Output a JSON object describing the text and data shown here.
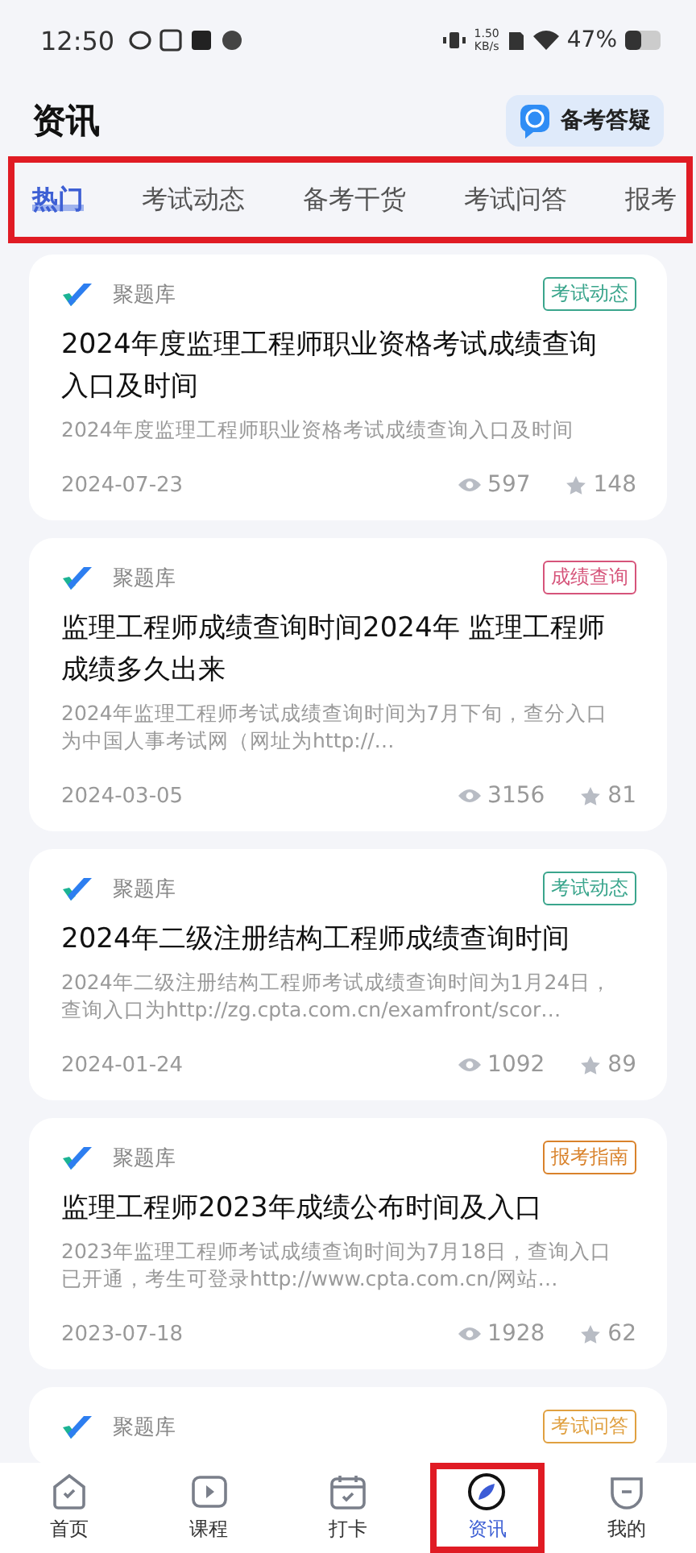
{
  "status_bar": {
    "time": "12:50",
    "net_speed_value": "1.50",
    "net_speed_unit": "KB/s",
    "battery": "47%"
  },
  "header": {
    "title": "资讯",
    "action": "备考答疑"
  },
  "tabs": [
    {
      "label": "热门",
      "selected": true
    },
    {
      "label": "考试动态",
      "selected": false
    },
    {
      "label": "备考干货",
      "selected": false
    },
    {
      "label": "考试问答",
      "selected": false
    },
    {
      "label": "报考",
      "selected": false
    }
  ],
  "articles": [
    {
      "source": "聚题库",
      "tag": "考试动态",
      "color": "#3aa58c",
      "title": "2024年度监理工程师职业资格考试成绩查询入口及时间",
      "summary": "2024年度监理工程师职业资格考试成绩查询入口及时间",
      "date": "2024-07-23",
      "views": "597",
      "stars": "148"
    },
    {
      "source": "聚题库",
      "tag": "成绩查询",
      "color": "#d6547a",
      "title": "监理工程师成绩查询时间2024年 监理工程师成绩多久出来",
      "summary": "2024年监理工程师考试成绩查询时间为7月下旬，查分入口为中国人事考试网（网址为http://…",
      "date": "2024-03-05",
      "views": "3156",
      "stars": "81"
    },
    {
      "source": "聚题库",
      "tag": "考试动态",
      "color": "#3aa58c",
      "title": "2024年二级注册结构工程师成绩查询时间",
      "summary": "2024年二级注册结构工程师考试成绩查询时间为1月24日，查询入口为http://zg.cpta.com.cn/examfront/scor…",
      "date": "2024-01-24",
      "views": "1092",
      "stars": "89"
    },
    {
      "source": "聚题库",
      "tag": "报考指南",
      "color": "#d9822b",
      "title": "监理工程师2023年成绩公布时间及入口",
      "summary": "2023年监理工程师考试成绩查询时间为7月18日，查询入口已开通，考生可登录http://www.cpta.com.cn/网站…",
      "date": "2023-07-18",
      "views": "1928",
      "stars": "62"
    },
    {
      "source": "聚题库",
      "tag": "考试问答",
      "color": "#e0a040"
    }
  ],
  "bottom_nav": [
    {
      "label": "首页",
      "kind": "home",
      "selected": false
    },
    {
      "label": "课程",
      "kind": "play",
      "selected": false
    },
    {
      "label": "打卡",
      "kind": "calendar",
      "selected": false
    },
    {
      "label": "资讯",
      "kind": "compass",
      "selected": true
    },
    {
      "label": "我的",
      "kind": "user",
      "selected": false
    }
  ]
}
